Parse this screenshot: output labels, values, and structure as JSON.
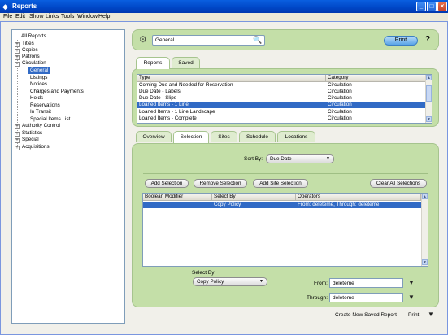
{
  "window": {
    "title": "Reports"
  },
  "menu": [
    "File",
    "Edit",
    "Show",
    "Links",
    "Tools",
    "Window",
    "Help"
  ],
  "tree": [
    {
      "label": "All Reports",
      "toggle": "",
      "level": 0
    },
    {
      "label": "Titles",
      "toggle": "+",
      "level": 0
    },
    {
      "label": "Copies",
      "toggle": "+",
      "level": 0
    },
    {
      "label": "Patrons",
      "toggle": "+",
      "level": 0
    },
    {
      "label": "Circulation",
      "toggle": "-",
      "level": 0
    },
    {
      "label": "General",
      "toggle": "",
      "level": 1,
      "selected": true
    },
    {
      "label": "Listings",
      "toggle": "",
      "level": 1
    },
    {
      "label": "Notices",
      "toggle": "",
      "level": 1
    },
    {
      "label": "Charges and Payments",
      "toggle": "",
      "level": 1
    },
    {
      "label": "Holds",
      "toggle": "",
      "level": 1
    },
    {
      "label": "Reservations",
      "toggle": "",
      "level": 1
    },
    {
      "label": "In Transit",
      "toggle": "",
      "level": 1
    },
    {
      "label": "Special Items List",
      "toggle": "",
      "level": 1
    },
    {
      "label": "Authority Control",
      "toggle": "+",
      "level": 0
    },
    {
      "label": "Statistics",
      "toggle": "+",
      "level": 0
    },
    {
      "label": "Special",
      "toggle": "+",
      "level": 0
    },
    {
      "label": "Acquisitions",
      "toggle": "+",
      "level": 0
    }
  ],
  "search": {
    "value": "General",
    "icon": "magnifier-icon"
  },
  "toolbar": {
    "print_label": "Print",
    "help_label": "?"
  },
  "top_tabs": [
    {
      "label": "Reports",
      "active": true
    },
    {
      "label": "Saved",
      "active": false
    }
  ],
  "report_list": {
    "headers": [
      "Type",
      "Category"
    ],
    "rows": [
      {
        "type": "Coming Due and Needed for Reservation",
        "category": "Circulation"
      },
      {
        "type": "Due Date - Labels",
        "category": "Circulation"
      },
      {
        "type": "Due Date - Slips",
        "category": "Circulation"
      },
      {
        "type": "Loaned Items - 1 Line",
        "category": "Circulation",
        "selected": true
      },
      {
        "type": "Loaned Items - 1 Line Landscape",
        "category": "Circulation"
      },
      {
        "type": "Loaned Items - Complete",
        "category": "Circulation"
      }
    ]
  },
  "sub_tabs": [
    {
      "label": "Overview",
      "active": false
    },
    {
      "label": "Selection",
      "active": true
    },
    {
      "label": "Sites",
      "active": false
    },
    {
      "label": "Schedule",
      "active": false
    },
    {
      "label": "Locations",
      "active": false
    }
  ],
  "sort": {
    "label": "Sort By:",
    "value": "Due Date"
  },
  "selection_buttons": {
    "add": "Add Selection",
    "remove": "Remove Selection",
    "add_site": "Add Site Selection",
    "clear": "Clear All Selections"
  },
  "selection_table": {
    "headers": [
      "Boolean Modifier",
      "Select By",
      "Operators"
    ],
    "rows": [
      {
        "modifier": "",
        "select_by": "Copy Policy",
        "operators": "From: deleteme, Through: deleteme",
        "selected": true
      }
    ]
  },
  "select_by": {
    "label": "Select By:",
    "value": "Copy Policy"
  },
  "range": {
    "from_label": "From:",
    "from_value": "deleteme",
    "through_label": "Through:",
    "through_value": "deleteme"
  },
  "footer": {
    "create_saved": "Create New Saved Report",
    "print": "Print"
  },
  "colors": {
    "panel_green": "#c4dfa8",
    "selection_blue": "#316ac5",
    "title_blue": "#0048c8"
  }
}
